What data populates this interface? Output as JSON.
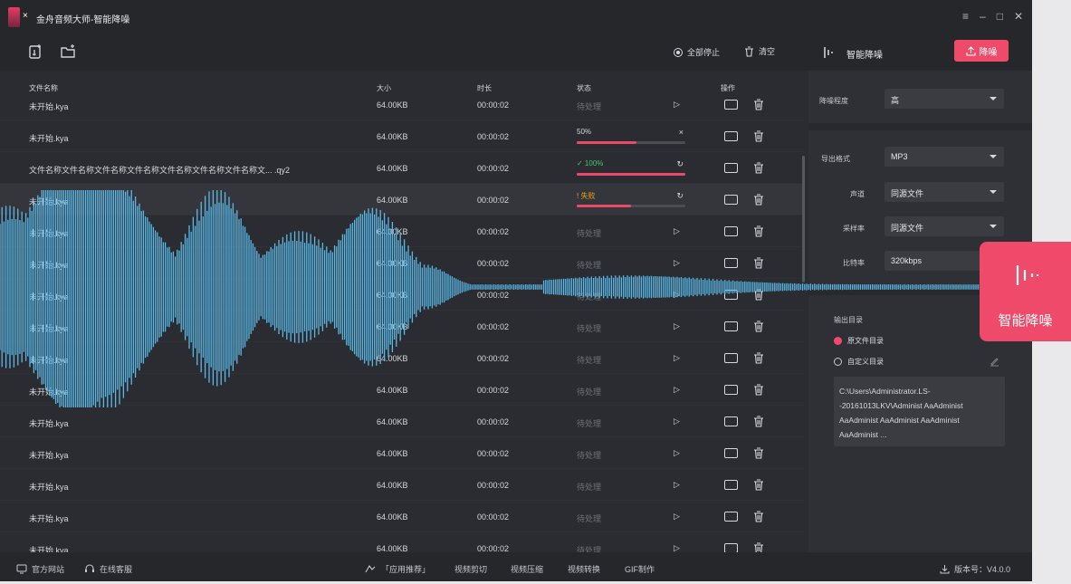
{
  "app": {
    "title": "金舟音频大师-智能降噪",
    "close_x": "×"
  },
  "window_controls": [
    "≡",
    "–",
    "□",
    "✕"
  ],
  "toolbar": {
    "stop_all_label": "全部停止",
    "clear_label": "清空"
  },
  "table": {
    "headers": {
      "name": "文件名称",
      "size": "大小",
      "duration": "时长",
      "status": "状态",
      "actions": "操作"
    },
    "rows": [
      {
        "name": "未开始.kya",
        "size": "64.00KB",
        "duration": "00:00:02",
        "status": "待处理",
        "kind": "pending"
      },
      {
        "name": "未开始.kya",
        "size": "64.00KB",
        "duration": "00:00:02",
        "status": "50%",
        "kind": "progress",
        "progress": 0.55,
        "action": "×"
      },
      {
        "name": "文件名称文件名称文件名称文件名称文件名称文件名称文件名称文... .qy2",
        "size": "64.00KB",
        "duration": "00:00:02",
        "status": "✓ 100%",
        "kind": "done",
        "progress": 1.0,
        "action": "↻"
      },
      {
        "name": "未开始.kya",
        "size": "64.00KB",
        "duration": "00:00:02",
        "status": "! 失败",
        "kind": "failed",
        "progress": 0.5,
        "action": "↻"
      },
      {
        "name": "未开始.kya",
        "size": "64.00KB",
        "duration": "00:00:02",
        "status": "待处理",
        "kind": "pending"
      },
      {
        "name": "未开始.kya",
        "size": "64.00KB",
        "duration": "00:00:02",
        "status": "待处理",
        "kind": "pending"
      },
      {
        "name": "未开始.kya",
        "size": "64.00KB",
        "duration": "00:00:02",
        "status": "待处理",
        "kind": "pending"
      },
      {
        "name": "未开始.kya",
        "size": "64.00KB",
        "duration": "00:00:02",
        "status": "待处理",
        "kind": "pending"
      },
      {
        "name": "未开始.kya",
        "size": "64.00KB",
        "duration": "00:00:02",
        "status": "待处理",
        "kind": "pending"
      },
      {
        "name": "未开始.kya",
        "size": "64.00KB",
        "duration": "00:00:02",
        "status": "待处理",
        "kind": "pending"
      },
      {
        "name": "未开始.kya",
        "size": "64.00KB",
        "duration": "00:00:02",
        "status": "待处理",
        "kind": "pending"
      },
      {
        "name": "未开始.kya",
        "size": "64.00KB",
        "duration": "00:00:02",
        "status": "待处理",
        "kind": "pending"
      },
      {
        "name": "未开始.kya",
        "size": "64.00KB",
        "duration": "00:00:02",
        "status": "待处理",
        "kind": "pending"
      },
      {
        "name": "未开始.kya",
        "size": "64.00KB",
        "duration": "00:00:02",
        "status": "待处理",
        "kind": "pending"
      },
      {
        "name": "未开始.kya",
        "size": "64.00KB",
        "duration": "00:00:02",
        "status": "待处理",
        "kind": "pending"
      }
    ]
  },
  "panel": {
    "title": "智能降噪",
    "denoise_button": "降噪",
    "level_label": "降噪程度",
    "level_value": "高",
    "format_label": "导出格式",
    "format_value": "MP3",
    "channel_label": "声道",
    "channel_value": "同源文件",
    "samplerate_label": "采样率",
    "samplerate_value": "同源文件",
    "bitrate_label": "比特率",
    "bitrate_value": "320kbps",
    "output_dir_label": "输出目录",
    "option_source": "原文件目录",
    "option_custom": "自定义目录",
    "path_text": "C:\\Users\\Administrator.LS--20161013LKV\\Administ AaAdminist AaAdminist AaAdminist AaAdminist AaAdminist ..."
  },
  "float_badge": {
    "label": "智能降噪"
  },
  "bottombar": {
    "website": "官方网站",
    "support": "在线客服",
    "recommend": "「应用推荐」",
    "links": [
      "视频剪切",
      "视频压缩",
      "视频转换",
      "GIF制作"
    ],
    "version": "版本号：V4.0.0"
  },
  "colors": {
    "accent": "#f04a6a",
    "wave": "#5bb8e6",
    "bg": "#2a2c31"
  }
}
